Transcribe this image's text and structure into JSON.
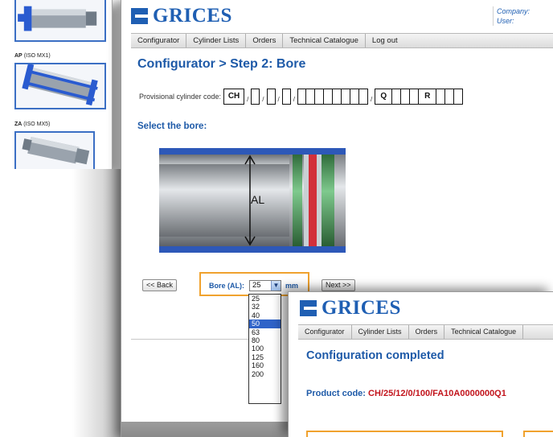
{
  "back_window": {
    "captions": [
      {
        "code": "AP",
        "standard": "(ISO MX1)"
      },
      {
        "code": "ZA",
        "standard": "(ISO MX5)"
      }
    ]
  },
  "main_window": {
    "logo": "GRICES",
    "company_label": "Company:",
    "user_label": "User:",
    "nav": [
      "Configurator",
      "Cylinder Lists",
      "Orders",
      "Technical Catalogue",
      "Log out"
    ],
    "title": "Configurator > Step 2: Bore",
    "provisional_label": "Provisional cylinder code:",
    "code_boxes": {
      "first": "CH",
      "q": "Q",
      "r": "R"
    },
    "separator": "/",
    "section_title": "Select the bore:",
    "diagram_label": "AL",
    "back_button": "<< Back",
    "next_button": "Next >>",
    "bore_label": "Bore (AL):",
    "bore_selected": "25",
    "bore_unit": "mm",
    "bore_options": [
      "25",
      "32",
      "40",
      "50",
      "63",
      "80",
      "100",
      "125",
      "160",
      "200"
    ],
    "highlighted_option": "50"
  },
  "front_window": {
    "logo": "GRICES",
    "nav": [
      "Configurator",
      "Cylinder Lists",
      "Orders",
      "Technical Catalogue"
    ],
    "title": "Configuration completed",
    "product_code_label": "Product code:",
    "product_code_value": "CH/25/12/0/100/FA10A0000000Q1"
  },
  "colors": {
    "brand_blue": "#1f5fb3",
    "title_blue": "#1e5aa8",
    "highlight_orange": "#f0a22e",
    "code_red": "#c2141c",
    "selection_blue": "#2f63c8"
  }
}
